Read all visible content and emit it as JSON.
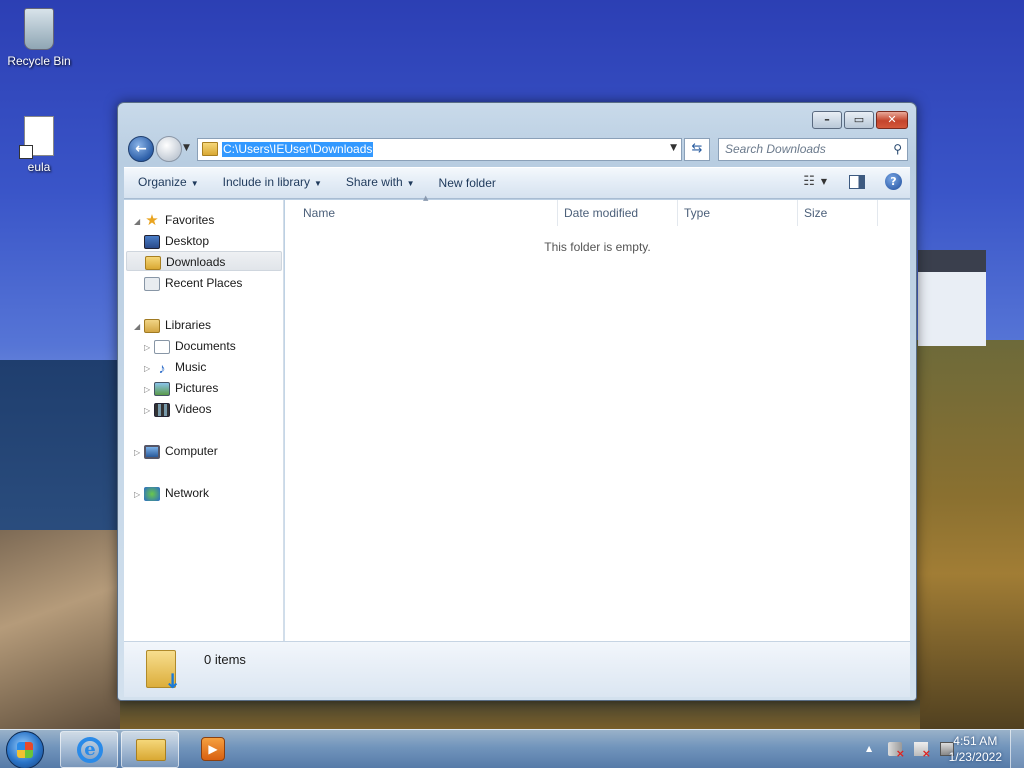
{
  "desktop": {
    "icons": [
      {
        "label": "Recycle Bin"
      },
      {
        "label": "eula"
      }
    ]
  },
  "window": {
    "caption_buttons": {
      "minimize": "–",
      "maximize": "▭",
      "close": "✕"
    },
    "address": {
      "path": "C:\\Users\\IEUser\\Downloads"
    },
    "search": {
      "placeholder": "Search Downloads"
    },
    "toolbar": {
      "organize": "Organize",
      "include_in_library": "Include in library",
      "share_with": "Share with",
      "new_folder": "New folder"
    },
    "nav_pane": {
      "favorites": "Favorites",
      "desktop": "Desktop",
      "downloads": "Downloads",
      "recent_places": "Recent Places",
      "libraries": "Libraries",
      "documents": "Documents",
      "music": "Music",
      "pictures": "Pictures",
      "videos": "Videos",
      "computer": "Computer",
      "network": "Network"
    },
    "columns": {
      "name": "Name",
      "date_modified": "Date modified",
      "type": "Type",
      "size": "Size"
    },
    "empty_message": "This folder is empty.",
    "details": {
      "item_count": "0 items"
    }
  },
  "taskbar": {
    "clock": {
      "time": "4:51 AM",
      "date": "1/23/2022"
    }
  }
}
